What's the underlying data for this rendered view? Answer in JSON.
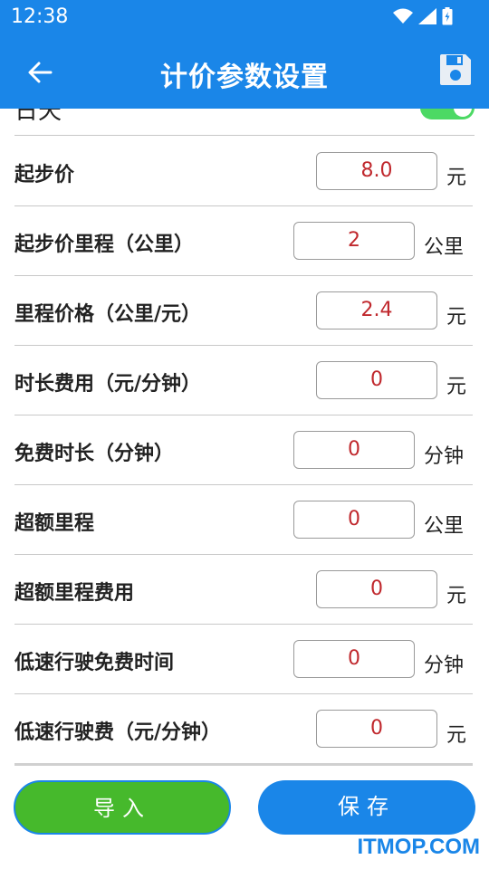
{
  "status_bar": {
    "time": "12:38",
    "icons": [
      "wifi-icon",
      "signal-icon",
      "battery-icon"
    ]
  },
  "app_bar": {
    "title": "计价参数设置",
    "back_icon": "arrow-left-icon",
    "save_icon": "floppy-disk-icon"
  },
  "partial_row": {
    "label": "日天",
    "toggle_on": true
  },
  "rows": [
    {
      "label": "起步价",
      "value": "8.0",
      "unit": "元"
    },
    {
      "label": "起步价里程（公里）",
      "value": "2",
      "unit": "公里"
    },
    {
      "label": "里程价格（公里/元）",
      "value": "2.4",
      "unit": "元"
    },
    {
      "label": "时长费用（元/分钟）",
      "value": "0",
      "unit": "元"
    },
    {
      "label": "免费时长（分钟）",
      "value": "0",
      "unit": "分钟"
    },
    {
      "label": "超额里程",
      "value": "0",
      "unit": "公里"
    },
    {
      "label": "超额里程费用",
      "value": "0",
      "unit": "元"
    },
    {
      "label": "低速行驶免费时间",
      "value": "0",
      "unit": "分钟"
    },
    {
      "label": "低速行驶费（元/分钟）",
      "value": "0",
      "unit": "元"
    }
  ],
  "buttons": {
    "import": "导入",
    "save": "保存"
  },
  "watermark": "ITMOP.COM",
  "colors": {
    "primary": "#1a86e8",
    "import_button": "#46b92c",
    "value_text": "#c0282d",
    "toggle_on": "#4cd964"
  }
}
